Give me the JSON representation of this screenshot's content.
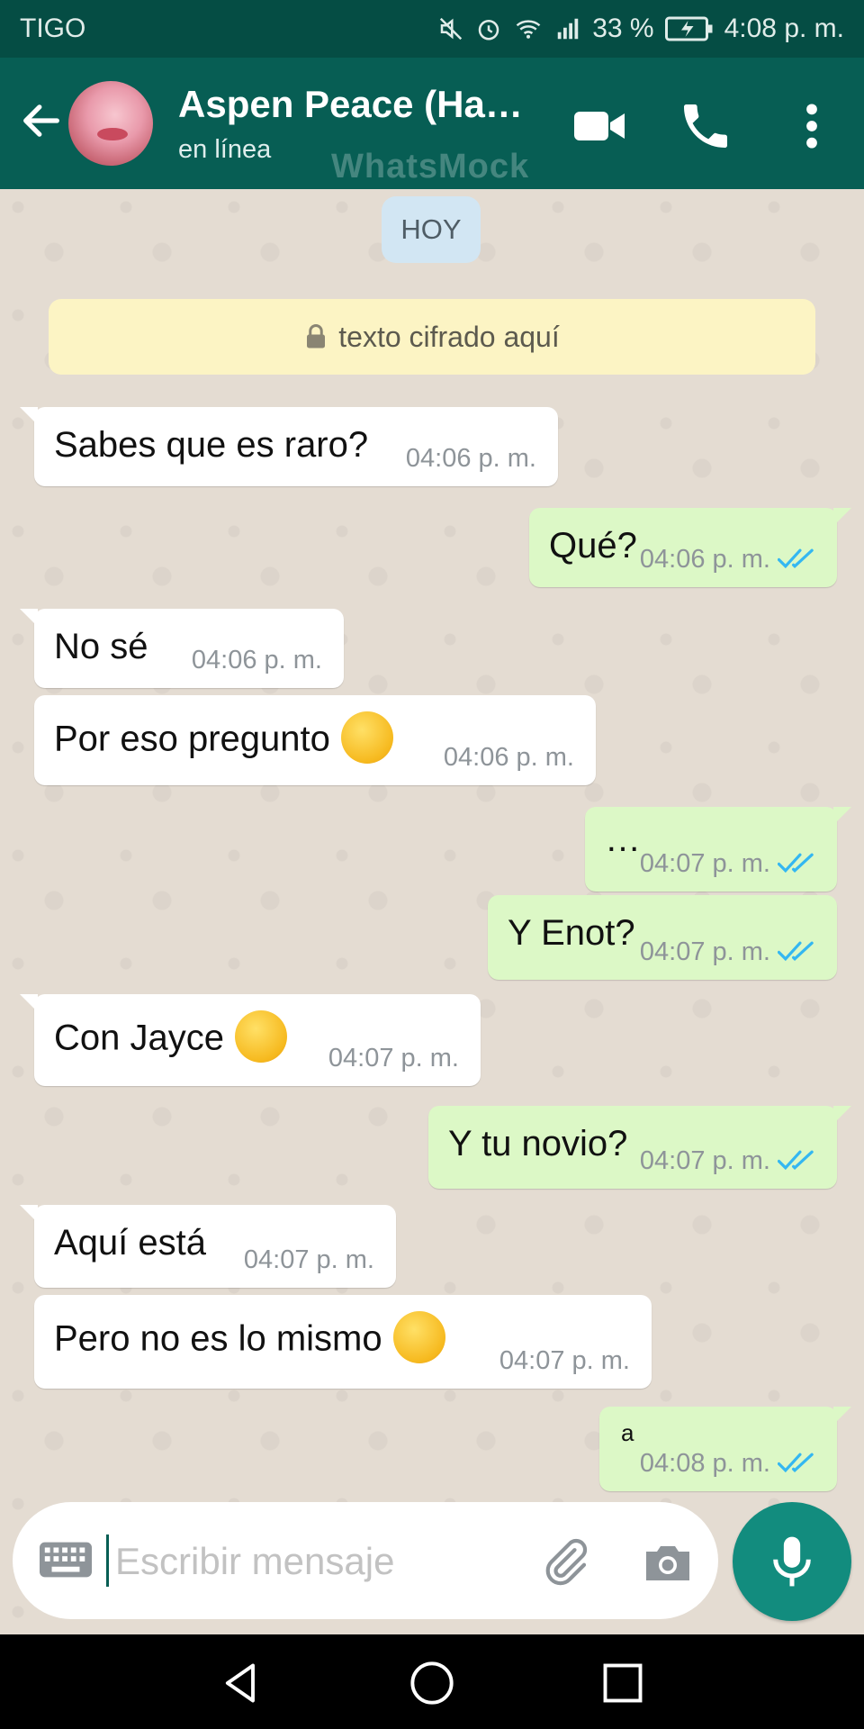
{
  "status_bar": {
    "carrier": "TIGO",
    "battery": "33 %",
    "time": "4:08 p. m.",
    "icons": [
      "mute-icon",
      "alarm-icon",
      "wifi-icon",
      "signal-icon",
      "battery-charging-icon"
    ]
  },
  "header": {
    "contact_name": "Aspen Peace (Ha…",
    "status": "en línea",
    "watermark": "WhatsMock",
    "icons": [
      "back-arrow-icon",
      "video-call-icon",
      "phone-icon",
      "more-vert-icon"
    ]
  },
  "chat": {
    "day_chip": "HOY",
    "encryption_notice": "texto cifrado aquí",
    "messages": [
      {
        "dir": "in",
        "text": "Sabes que es raro?",
        "time": "04:06 p. m."
      },
      {
        "dir": "out",
        "text": "Qué?",
        "time": "04:06 p. m.",
        "ticks": "read"
      },
      {
        "dir": "in",
        "text": "No sé",
        "time": "04:06 p. m."
      },
      {
        "dir": "in",
        "text": "Por eso pregunto",
        "emoji": "face-with-rolling-eyes",
        "time": "04:06 p. m."
      },
      {
        "dir": "out",
        "text": "…",
        "time": "04:07 p. m.",
        "ticks": "read"
      },
      {
        "dir": "out",
        "text": "Y Enot?",
        "time": "04:07 p. m.",
        "ticks": "read"
      },
      {
        "dir": "in",
        "text": "Con Jayce",
        "emoji": "pensive-face",
        "time": "04:07 p. m."
      },
      {
        "dir": "out",
        "text": "Y tu novio?",
        "time": "04:07 p. m.",
        "ticks": "read"
      },
      {
        "dir": "in",
        "text": "Aquí está",
        "time": "04:07 p. m."
      },
      {
        "dir": "in",
        "text": "Pero no es lo mismo",
        "emoji": "crying-cat-face",
        "time": "04:07 p. m."
      },
      {
        "dir": "out",
        "text": "a",
        "time": "04:08 p. m.",
        "ticks": "read"
      }
    ]
  },
  "composer": {
    "placeholder": "Escribir mensaje",
    "value": "",
    "icons": [
      "keyboard-icon",
      "attach-icon",
      "camera-icon",
      "mic-icon"
    ]
  },
  "colors": {
    "header": "#075e54",
    "status_bar": "#054d44",
    "incoming_bubble": "#ffffff",
    "outgoing_bubble": "#dcf8c6",
    "read_ticks": "#34b7f1",
    "mic_button": "#128c7e"
  }
}
